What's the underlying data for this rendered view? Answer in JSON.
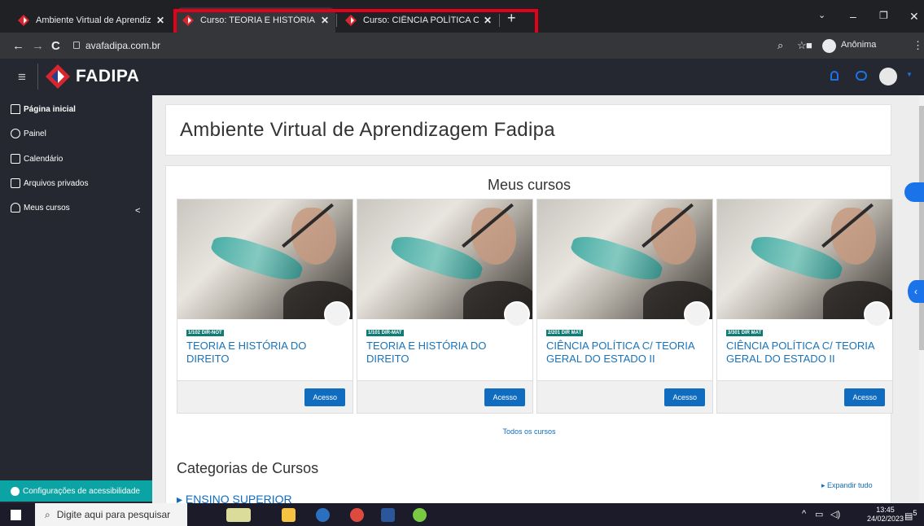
{
  "browser": {
    "tabs": [
      {
        "label": "Ambiente Virtual de Aprendizage",
        "active": false
      },
      {
        "label": "Curso: TEORIA E HISTÓRIA DO D",
        "active": true
      },
      {
        "label": "Curso: CIÊNCIA POLÍTICA C/ TEO",
        "active": false
      }
    ],
    "new_tab": "+",
    "url": "avafadipa.com.br",
    "profile_label": "Anônima"
  },
  "header": {
    "logo_text": "FADIPA"
  },
  "sidebar": {
    "items": [
      {
        "label": "Página inicial",
        "icon": "home-icon"
      },
      {
        "label": "Painel",
        "icon": "gauge-icon"
      },
      {
        "label": "Calendário",
        "icon": "calendar-icon"
      },
      {
        "label": "Arquivos privados",
        "icon": "files-icon"
      },
      {
        "label": "Meus cursos",
        "icon": "graduation-icon"
      }
    ],
    "chevron": "<",
    "accessibility_label": "Configurações de acessibilidade"
  },
  "main": {
    "page_title": "Ambiente Virtual de Aprendizagem Fadipa",
    "my_courses_title": "Meus cursos",
    "courses": [
      {
        "badge": "1/102 DIR-NOT",
        "name": "TEORIA E HISTÓRIA DO DIREITO",
        "button": "Acesso"
      },
      {
        "badge": "1/101 DIR-MAT",
        "name": "TEORIA E HISTÓRIA DO DIREITO",
        "button": "Acesso"
      },
      {
        "badge": "2/201 DIR MAT",
        "name": "CIÊNCIA POLÍTICA C/ TEORIA GERAL DO ESTADO II",
        "button": "Acesso"
      },
      {
        "badge": "3/301 DIR MAT",
        "name": "CIÊNCIA POLÍTICA C/ TEORIA GERAL DO ESTADO II",
        "button": "Acesso"
      }
    ],
    "all_courses_link": "Todos os cursos",
    "categories_title": "Categorias de Cursos",
    "expand_all": "Expandir tudo",
    "first_category": "ENSINO SUPERIOR"
  },
  "taskbar": {
    "search_placeholder": "Digite aqui para pesquisar",
    "time": "13:45",
    "date": "24/02/2023",
    "notification_count": "5"
  },
  "colors": {
    "chrome_dark": "#202124",
    "moodle_header": "#252830",
    "accent_blue": "#0f6cbf",
    "badge_green": "#0f7c73",
    "highlight_red": "#e2001a",
    "brand_red": "#d7262e"
  }
}
